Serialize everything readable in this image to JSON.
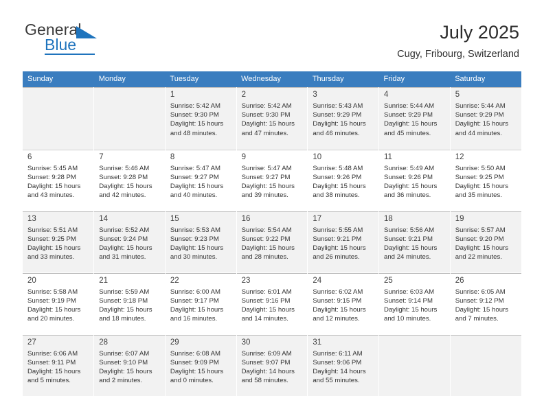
{
  "brand": {
    "name_part1": "General",
    "name_part2": "Blue",
    "flag_icon": "flag-triangle-icon",
    "accent_color": "#1f74bd"
  },
  "header": {
    "title": "July 2025",
    "location": "Cugy, Fribourg, Switzerland"
  },
  "calendar": {
    "header_color": "#3a7dbf",
    "weekday_headers": [
      "Sunday",
      "Monday",
      "Tuesday",
      "Wednesday",
      "Thursday",
      "Friday",
      "Saturday"
    ],
    "weeks": [
      {
        "shaded": true,
        "days": [
          {
            "num": "",
            "sunrise": "",
            "sunset": "",
            "daylight1": "",
            "daylight2": ""
          },
          {
            "num": "",
            "sunrise": "",
            "sunset": "",
            "daylight1": "",
            "daylight2": ""
          },
          {
            "num": "1",
            "sunrise": "Sunrise: 5:42 AM",
            "sunset": "Sunset: 9:30 PM",
            "daylight1": "Daylight: 15 hours",
            "daylight2": "and 48 minutes."
          },
          {
            "num": "2",
            "sunrise": "Sunrise: 5:42 AM",
            "sunset": "Sunset: 9:30 PM",
            "daylight1": "Daylight: 15 hours",
            "daylight2": "and 47 minutes."
          },
          {
            "num": "3",
            "sunrise": "Sunrise: 5:43 AM",
            "sunset": "Sunset: 9:29 PM",
            "daylight1": "Daylight: 15 hours",
            "daylight2": "and 46 minutes."
          },
          {
            "num": "4",
            "sunrise": "Sunrise: 5:44 AM",
            "sunset": "Sunset: 9:29 PM",
            "daylight1": "Daylight: 15 hours",
            "daylight2": "and 45 minutes."
          },
          {
            "num": "5",
            "sunrise": "Sunrise: 5:44 AM",
            "sunset": "Sunset: 9:29 PM",
            "daylight1": "Daylight: 15 hours",
            "daylight2": "and 44 minutes."
          }
        ]
      },
      {
        "shaded": false,
        "days": [
          {
            "num": "6",
            "sunrise": "Sunrise: 5:45 AM",
            "sunset": "Sunset: 9:28 PM",
            "daylight1": "Daylight: 15 hours",
            "daylight2": "and 43 minutes."
          },
          {
            "num": "7",
            "sunrise": "Sunrise: 5:46 AM",
            "sunset": "Sunset: 9:28 PM",
            "daylight1": "Daylight: 15 hours",
            "daylight2": "and 42 minutes."
          },
          {
            "num": "8",
            "sunrise": "Sunrise: 5:47 AM",
            "sunset": "Sunset: 9:27 PM",
            "daylight1": "Daylight: 15 hours",
            "daylight2": "and 40 minutes."
          },
          {
            "num": "9",
            "sunrise": "Sunrise: 5:47 AM",
            "sunset": "Sunset: 9:27 PM",
            "daylight1": "Daylight: 15 hours",
            "daylight2": "and 39 minutes."
          },
          {
            "num": "10",
            "sunrise": "Sunrise: 5:48 AM",
            "sunset": "Sunset: 9:26 PM",
            "daylight1": "Daylight: 15 hours",
            "daylight2": "and 38 minutes."
          },
          {
            "num": "11",
            "sunrise": "Sunrise: 5:49 AM",
            "sunset": "Sunset: 9:26 PM",
            "daylight1": "Daylight: 15 hours",
            "daylight2": "and 36 minutes."
          },
          {
            "num": "12",
            "sunrise": "Sunrise: 5:50 AM",
            "sunset": "Sunset: 9:25 PM",
            "daylight1": "Daylight: 15 hours",
            "daylight2": "and 35 minutes."
          }
        ]
      },
      {
        "shaded": true,
        "days": [
          {
            "num": "13",
            "sunrise": "Sunrise: 5:51 AM",
            "sunset": "Sunset: 9:25 PM",
            "daylight1": "Daylight: 15 hours",
            "daylight2": "and 33 minutes."
          },
          {
            "num": "14",
            "sunrise": "Sunrise: 5:52 AM",
            "sunset": "Sunset: 9:24 PM",
            "daylight1": "Daylight: 15 hours",
            "daylight2": "and 31 minutes."
          },
          {
            "num": "15",
            "sunrise": "Sunrise: 5:53 AM",
            "sunset": "Sunset: 9:23 PM",
            "daylight1": "Daylight: 15 hours",
            "daylight2": "and 30 minutes."
          },
          {
            "num": "16",
            "sunrise": "Sunrise: 5:54 AM",
            "sunset": "Sunset: 9:22 PM",
            "daylight1": "Daylight: 15 hours",
            "daylight2": "and 28 minutes."
          },
          {
            "num": "17",
            "sunrise": "Sunrise: 5:55 AM",
            "sunset": "Sunset: 9:21 PM",
            "daylight1": "Daylight: 15 hours",
            "daylight2": "and 26 minutes."
          },
          {
            "num": "18",
            "sunrise": "Sunrise: 5:56 AM",
            "sunset": "Sunset: 9:21 PM",
            "daylight1": "Daylight: 15 hours",
            "daylight2": "and 24 minutes."
          },
          {
            "num": "19",
            "sunrise": "Sunrise: 5:57 AM",
            "sunset": "Sunset: 9:20 PM",
            "daylight1": "Daylight: 15 hours",
            "daylight2": "and 22 minutes."
          }
        ]
      },
      {
        "shaded": false,
        "days": [
          {
            "num": "20",
            "sunrise": "Sunrise: 5:58 AM",
            "sunset": "Sunset: 9:19 PM",
            "daylight1": "Daylight: 15 hours",
            "daylight2": "and 20 minutes."
          },
          {
            "num": "21",
            "sunrise": "Sunrise: 5:59 AM",
            "sunset": "Sunset: 9:18 PM",
            "daylight1": "Daylight: 15 hours",
            "daylight2": "and 18 minutes."
          },
          {
            "num": "22",
            "sunrise": "Sunrise: 6:00 AM",
            "sunset": "Sunset: 9:17 PM",
            "daylight1": "Daylight: 15 hours",
            "daylight2": "and 16 minutes."
          },
          {
            "num": "23",
            "sunrise": "Sunrise: 6:01 AM",
            "sunset": "Sunset: 9:16 PM",
            "daylight1": "Daylight: 15 hours",
            "daylight2": "and 14 minutes."
          },
          {
            "num": "24",
            "sunrise": "Sunrise: 6:02 AM",
            "sunset": "Sunset: 9:15 PM",
            "daylight1": "Daylight: 15 hours",
            "daylight2": "and 12 minutes."
          },
          {
            "num": "25",
            "sunrise": "Sunrise: 6:03 AM",
            "sunset": "Sunset: 9:14 PM",
            "daylight1": "Daylight: 15 hours",
            "daylight2": "and 10 minutes."
          },
          {
            "num": "26",
            "sunrise": "Sunrise: 6:05 AM",
            "sunset": "Sunset: 9:12 PM",
            "daylight1": "Daylight: 15 hours",
            "daylight2": "and 7 minutes."
          }
        ]
      },
      {
        "shaded": true,
        "days": [
          {
            "num": "27",
            "sunrise": "Sunrise: 6:06 AM",
            "sunset": "Sunset: 9:11 PM",
            "daylight1": "Daylight: 15 hours",
            "daylight2": "and 5 minutes."
          },
          {
            "num": "28",
            "sunrise": "Sunrise: 6:07 AM",
            "sunset": "Sunset: 9:10 PM",
            "daylight1": "Daylight: 15 hours",
            "daylight2": "and 2 minutes."
          },
          {
            "num": "29",
            "sunrise": "Sunrise: 6:08 AM",
            "sunset": "Sunset: 9:09 PM",
            "daylight1": "Daylight: 15 hours",
            "daylight2": "and 0 minutes."
          },
          {
            "num": "30",
            "sunrise": "Sunrise: 6:09 AM",
            "sunset": "Sunset: 9:07 PM",
            "daylight1": "Daylight: 14 hours",
            "daylight2": "and 58 minutes."
          },
          {
            "num": "31",
            "sunrise": "Sunrise: 6:11 AM",
            "sunset": "Sunset: 9:06 PM",
            "daylight1": "Daylight: 14 hours",
            "daylight2": "and 55 minutes."
          },
          {
            "num": "",
            "sunrise": "",
            "sunset": "",
            "daylight1": "",
            "daylight2": ""
          },
          {
            "num": "",
            "sunrise": "",
            "sunset": "",
            "daylight1": "",
            "daylight2": ""
          }
        ]
      }
    ]
  }
}
